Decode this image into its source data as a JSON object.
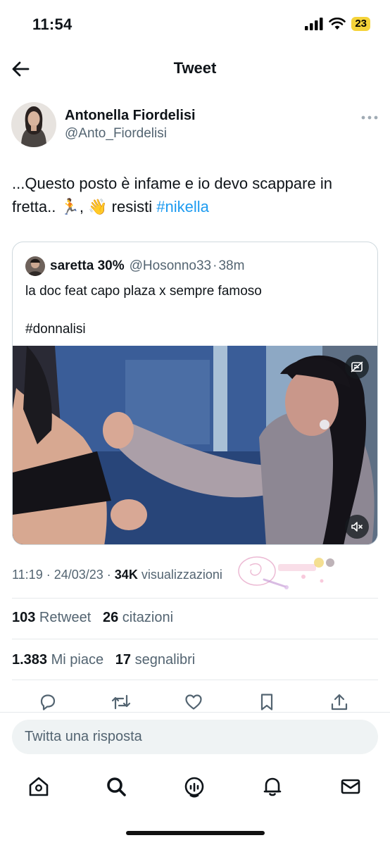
{
  "status_bar": {
    "time": "11:54",
    "battery": "23"
  },
  "header": {
    "title": "Tweet"
  },
  "author": {
    "name": "Antonella Fiordelisi",
    "handle": "@Anto_Fiordelisi"
  },
  "tweet": {
    "text_line1": "...Questo posto è infame e io devo scappare in",
    "text_line2_prefix": "fretta.. ",
    "text_runner": "🏃",
    "text_comma": ", ",
    "text_wave": "👋",
    "text_resisti": " resisti ",
    "hashtag": "#nikella"
  },
  "quote": {
    "name": "saretta 30%",
    "handle": "@Hosonno33",
    "sep": "·",
    "time": "38m",
    "text": "la doc feat  capo plaza x sempre famoso",
    "tag": "#donnalisi"
  },
  "meta": {
    "time": "11:19",
    "sep1": " · ",
    "date": "24/03/23",
    "sep2": " · ",
    "views": "34K",
    "views_label": " visualizzazioni"
  },
  "stats": {
    "retweets": "103",
    "retweets_label": " Retweet",
    "quotes": "26",
    "quotes_label": " citazioni",
    "likes": "1.383",
    "likes_label": " Mi piace",
    "bookmarks": "17",
    "bookmarks_label": " segnalibri"
  },
  "reply": {
    "placeholder": "Twitta una risposta"
  },
  "icons": {
    "back": "arrow-left-icon",
    "more": "more-dots-icon",
    "reply": "reply-icon",
    "retweet": "retweet-icon",
    "like": "heart-icon",
    "bookmark": "bookmark-icon",
    "share": "share-icon",
    "home": "home-icon",
    "search": "search-icon",
    "spaces": "spaces-icon",
    "notifications": "bell-icon",
    "messages": "mail-icon"
  },
  "colors": {
    "accent": "#1d9bf0",
    "text": "#0f1419",
    "secondary": "#536471",
    "battery": "#f5d33a"
  }
}
